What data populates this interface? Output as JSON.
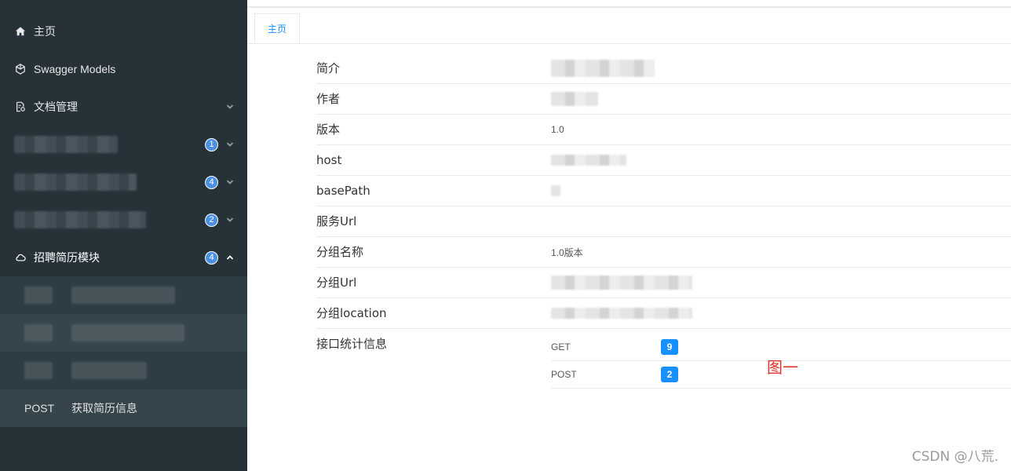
{
  "sidebar": {
    "items": [
      {
        "label": "主页",
        "icon": "home-icon"
      },
      {
        "label": "Swagger Models",
        "icon": "cube-icon"
      },
      {
        "label": "文档管理",
        "icon": "document-gear-icon"
      }
    ],
    "groups": [
      {
        "badge": "1"
      },
      {
        "badge": "4"
      },
      {
        "badge": "2"
      }
    ],
    "active_group": {
      "label": "招聘简历模块",
      "badge": "4",
      "icon": "cloud-icon"
    },
    "subitems": [
      {
        "method": "POST",
        "label": "获取简历信息"
      }
    ]
  },
  "tabs": [
    {
      "label": "主页"
    }
  ],
  "info": {
    "rows": [
      {
        "label": "简介",
        "value": ""
      },
      {
        "label": "作者",
        "value": ""
      },
      {
        "label": "版本",
        "value": "1.0"
      },
      {
        "label": "host",
        "value": ""
      },
      {
        "label": "basePath",
        "value": ""
      },
      {
        "label": "服务Url",
        "value": ""
      },
      {
        "label": "分组名称",
        "value": "1.0版本"
      },
      {
        "label": "分组Url",
        "value": ""
      },
      {
        "label": "分组location",
        "value": ""
      }
    ],
    "stats_label": "接口统计信息",
    "stats": [
      {
        "method": "GET",
        "count": "9"
      },
      {
        "method": "POST",
        "count": "2"
      }
    ]
  },
  "annotation": "图一",
  "watermark": "CSDN @八荒.",
  "colors": {
    "sidebar_bg": "#263238",
    "submenu_bg": "#2e3c43",
    "badge": "#4a90e2",
    "accent": "#1890ff",
    "annotation": "#e0302a"
  }
}
